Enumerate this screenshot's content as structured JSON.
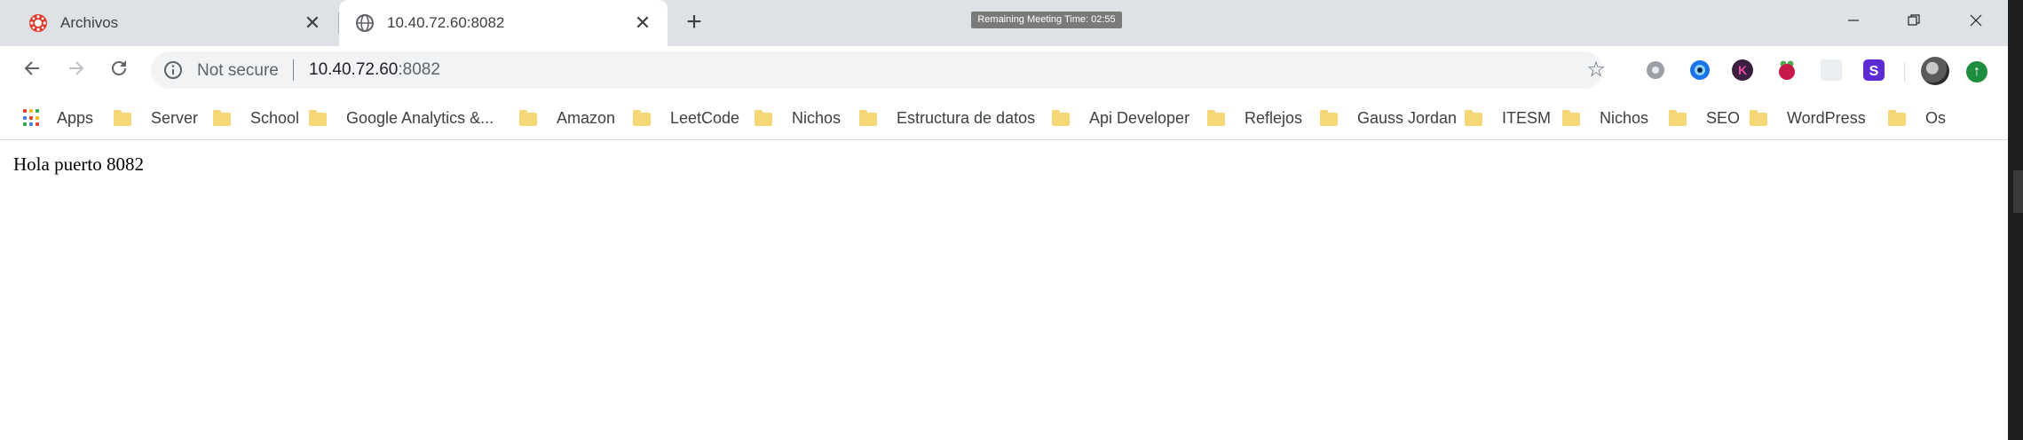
{
  "tabs": [
    {
      "label": "Archivos",
      "favicon": "canvas-logo-icon",
      "active": false
    },
    {
      "label": "10.40.72.60:8082",
      "favicon": "globe-icon",
      "active": true
    }
  ],
  "meeting_badge": "Remaining Meeting Time: 02:55",
  "omnibox": {
    "security_label": "Not secure",
    "url_host": "10.40.72.60",
    "url_port": ":8082"
  },
  "bookmarks": [
    {
      "label": "Apps",
      "icon": "apps-grid-icon"
    },
    {
      "label": "Server",
      "icon": "folder-icon"
    },
    {
      "label": "School",
      "icon": "folder-icon"
    },
    {
      "label": "Google Analytics &...",
      "icon": "folder-icon"
    },
    {
      "label": "Amazon",
      "icon": "folder-icon"
    },
    {
      "label": "LeetCode",
      "icon": "folder-icon"
    },
    {
      "label": "Nichos",
      "icon": "folder-icon"
    },
    {
      "label": "Estructura de datos",
      "icon": "folder-icon"
    },
    {
      "label": "Api Developer",
      "icon": "folder-icon"
    },
    {
      "label": "Reflejos",
      "icon": "folder-icon"
    },
    {
      "label": "Gauss Jordan",
      "icon": "folder-icon"
    },
    {
      "label": "ITESM",
      "icon": "folder-icon"
    },
    {
      "label": "Nichos",
      "icon": "folder-icon"
    },
    {
      "label": "SEO",
      "icon": "folder-icon"
    },
    {
      "label": "WordPress",
      "icon": "folder-icon"
    },
    {
      "label": "Os",
      "icon": "folder-icon"
    }
  ],
  "extensions": [
    {
      "name": "gear-extension-icon",
      "color": "#9aa0a6"
    },
    {
      "name": "eye-extension-icon",
      "color": "#1a73e8"
    },
    {
      "name": "k-extension-icon",
      "color": "#3b1f3f"
    },
    {
      "name": "raspberry-extension-icon",
      "color": "#c51a4a"
    },
    {
      "name": "blank-extension-icon",
      "color": "#e8eaed"
    },
    {
      "name": "s-extension-icon",
      "color": "#5b2bd6"
    }
  ],
  "page": {
    "text": "Hola puerto 8082"
  },
  "colors": {
    "tabstrip": "#dee1e6",
    "folder": "#f6d776",
    "update": "#1e8e3e"
  }
}
